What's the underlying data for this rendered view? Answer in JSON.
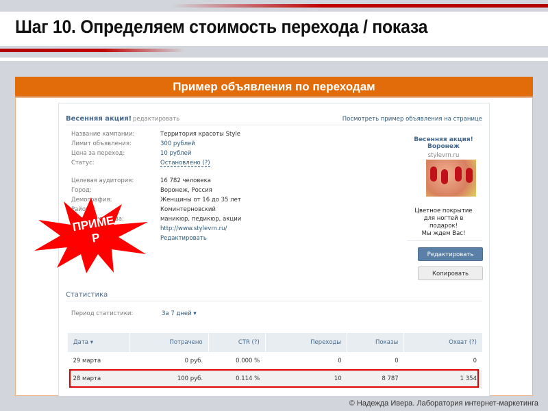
{
  "slide": {
    "title": "Шаг 10. Определяем стоимость перехода / показа",
    "section": "Пример объявления по переходам",
    "footer": "© Надежда Ивера. Лаборатория интернет-маркетинга",
    "stamp": "ПРИМЕ Р"
  },
  "ad": {
    "name": "Весенняя акция!",
    "edit_link": "редактировать",
    "preview_link": "Посмотреть пример объявления на странице",
    "fields": [
      {
        "label": "Название кампании:",
        "value": "Территория красоты Style"
      },
      {
        "label": "Лимит объявления:",
        "value": "300 рублей"
      },
      {
        "label": "Цена за переход:",
        "value": "10 рублей"
      },
      {
        "label": "Статус:",
        "value": "Остановлено (?)"
      }
    ],
    "targeting": [
      {
        "label": "Целевая аудитория:",
        "value": "16 782 человека"
      },
      {
        "label": "Город:",
        "value": "Воронеж, Россия"
      },
      {
        "label": "Демография:",
        "value": "Женщины от 16 до 35 лет"
      },
      {
        "label": "Районы:",
        "value": "Коминтерновский"
      },
      {
        "label": "Ключевые слова:",
        "value": "маникюр, педикюр, акции"
      },
      {
        "label": "Сайт:",
        "value": "http://www.stylevrn.ru/"
      }
    ],
    "edit_targeting": "Редактировать",
    "preview": {
      "title1": "Весенняя акция!",
      "title2": "Воронеж",
      "domain": "stylevrn.ru",
      "text": [
        "Цветное покрытие",
        "для ногтей в",
        "подарок!",
        "Мы ждем Вас!"
      ]
    },
    "edit_button": "Редактировать",
    "copy_button": "Копировать"
  },
  "stats": {
    "title": "Статистика",
    "period_label": "Период статистики:",
    "period_value": "За 7 дней ▾",
    "columns": [
      "Дата ▾",
      "Потрачено",
      "CTR (?)",
      "Переходы",
      "Показы",
      "Охват (?)"
    ],
    "rows": [
      [
        "29 марта",
        "0 руб.",
        "0.000 %",
        "0",
        "0",
        "0"
      ],
      [
        "28 марта",
        "100 руб.",
        "0.114 %",
        "10",
        "8 787",
        "1 354"
      ]
    ]
  }
}
